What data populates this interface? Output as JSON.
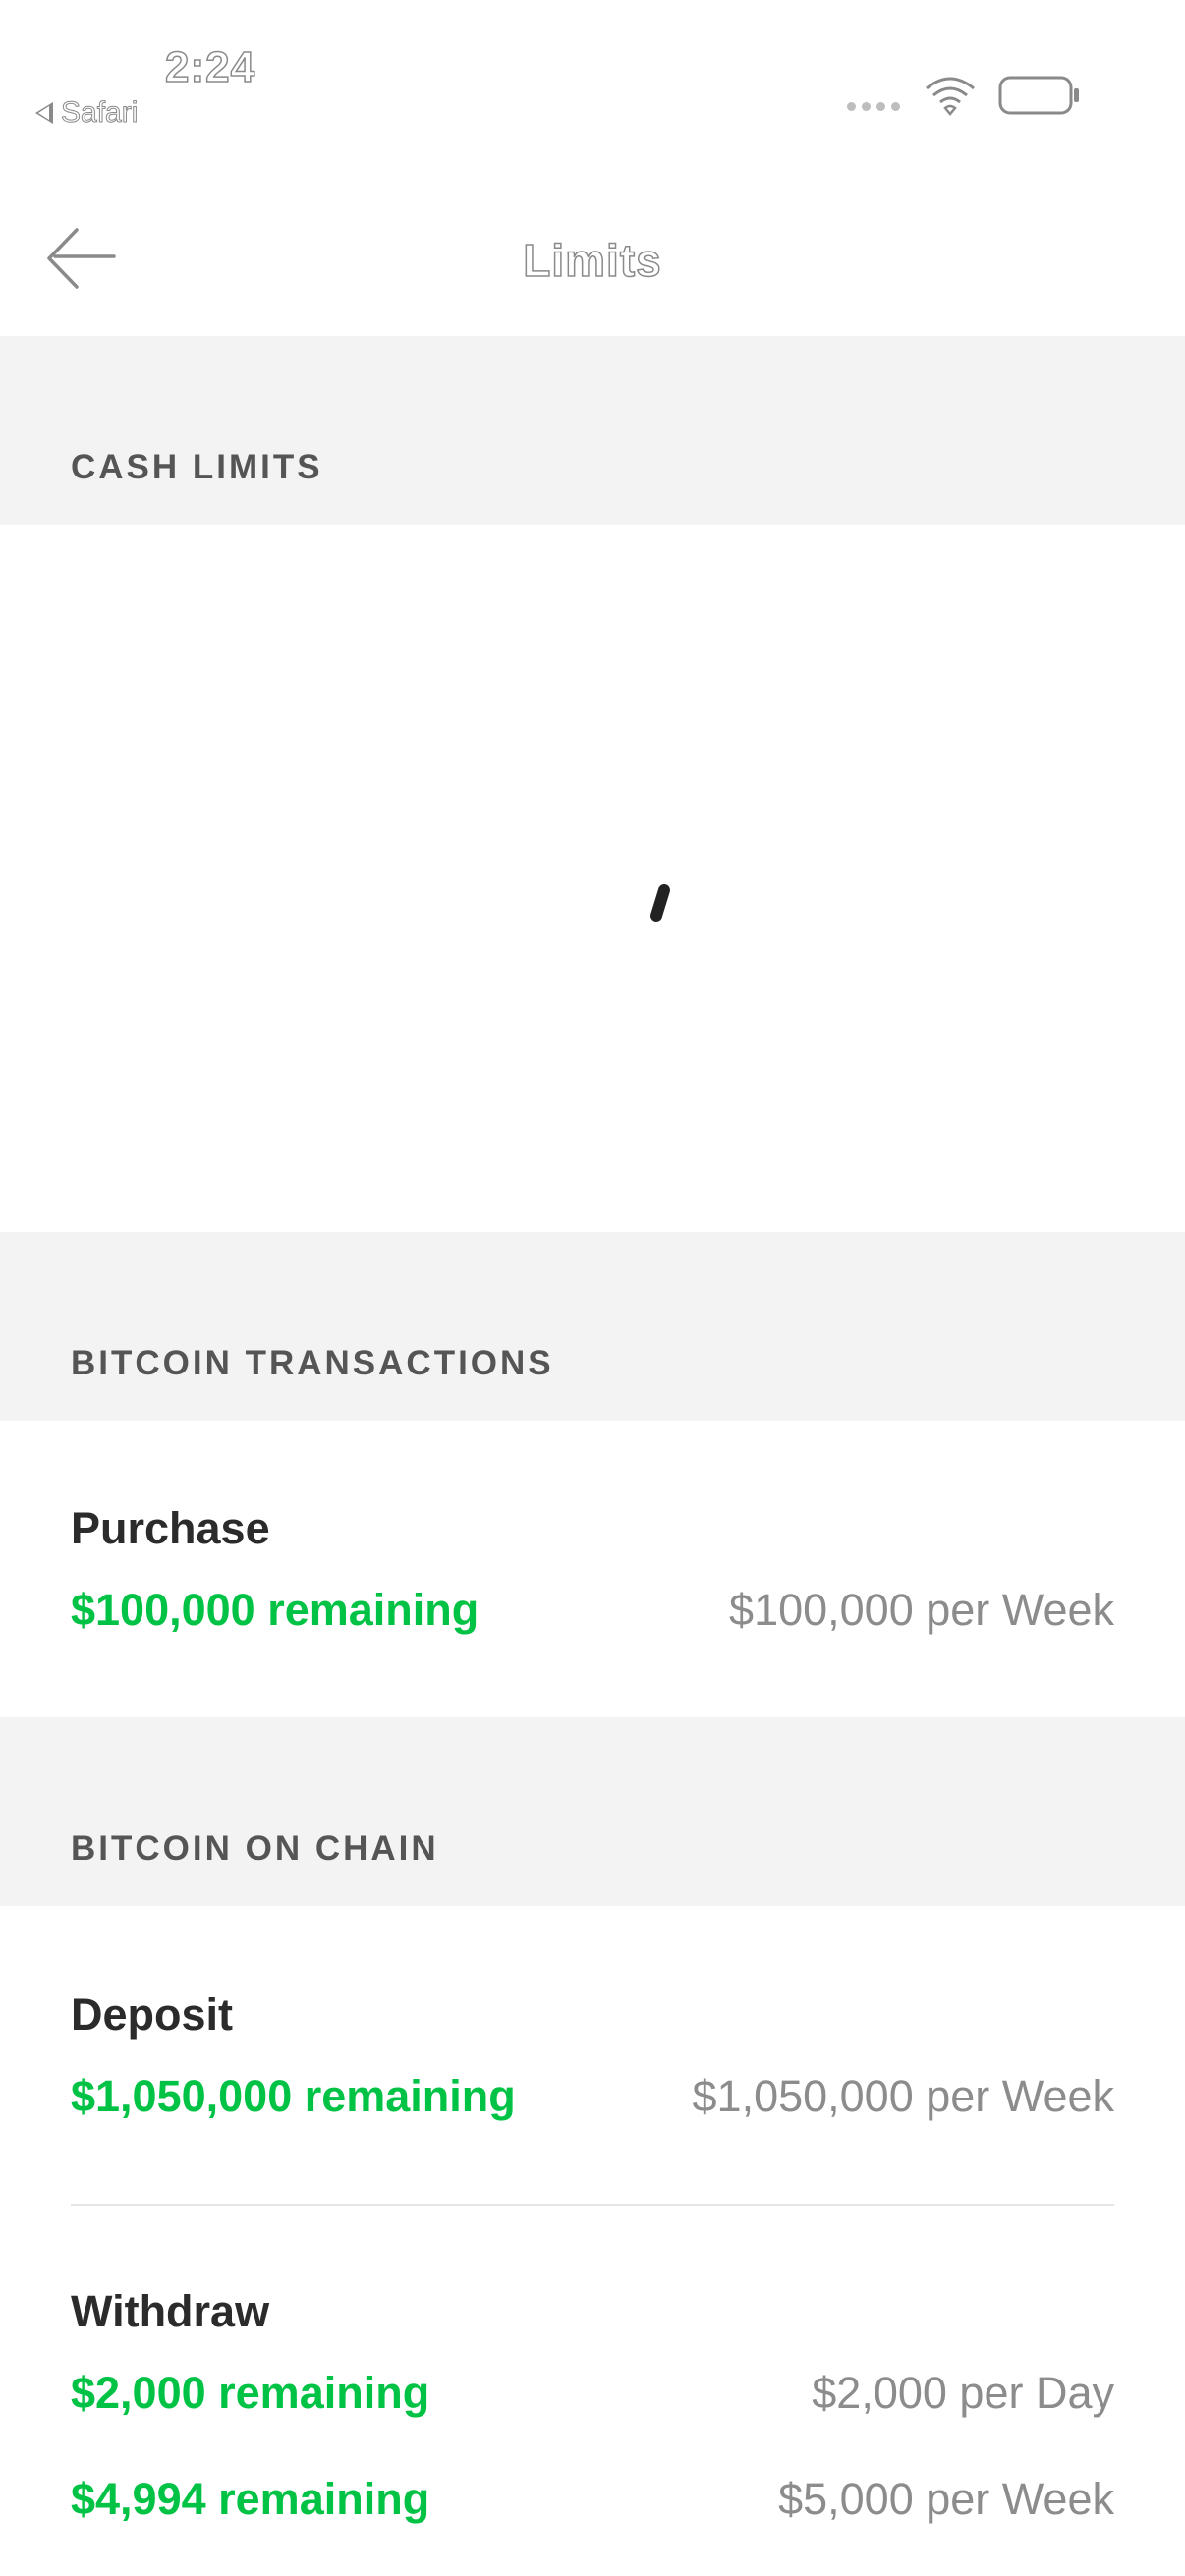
{
  "status_bar": {
    "time": "2:24",
    "back_app": "Safari"
  },
  "nav": {
    "title": "Limits"
  },
  "sections": {
    "cash": {
      "header": "CASH LIMITS"
    },
    "bitcoin_transactions": {
      "header": "BITCOIN TRANSACTIONS",
      "purchase": {
        "title": "Purchase",
        "remaining": "$100,000 remaining",
        "limit": "$100,000 per Week"
      }
    },
    "bitcoin_on_chain": {
      "header": "BITCOIN ON CHAIN",
      "deposit": {
        "title": "Deposit",
        "remaining": "$1,050,000 remaining",
        "limit": "$1,050,000 per Week"
      },
      "withdraw": {
        "title": "Withdraw",
        "daily_remaining": "$2,000 remaining",
        "daily_limit": "$2,000 per Day",
        "weekly_remaining": "$4,994 remaining",
        "weekly_limit": "$5,000 per Week"
      }
    }
  },
  "colors": {
    "accent_green": "#00c244",
    "section_bg": "#f3f3f3",
    "muted_text": "#8c8c8c"
  },
  "icons": {
    "nav_back": "arrow-left-icon",
    "wifi": "wifi-icon",
    "battery": "battery-icon",
    "signal": "signal-icon",
    "loading": "loading-spinner-icon"
  }
}
